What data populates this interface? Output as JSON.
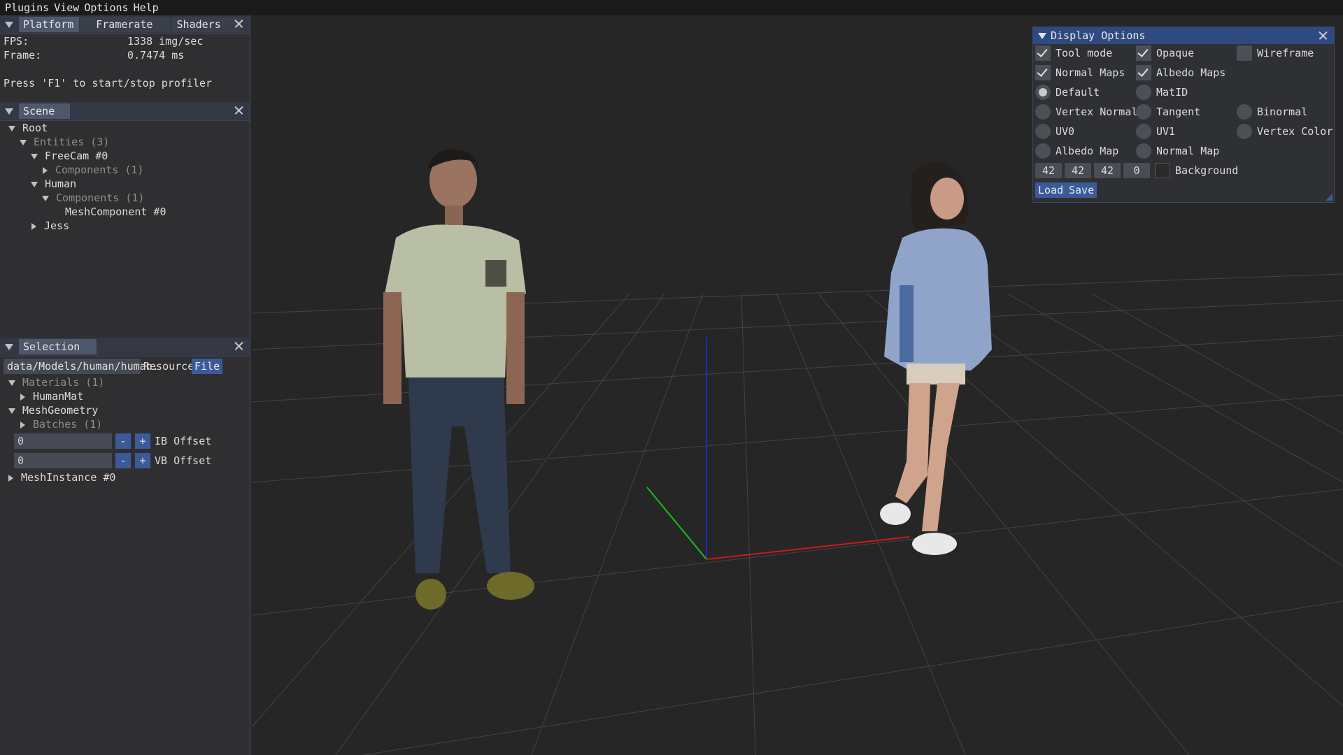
{
  "menubar": {
    "items": [
      "Plugins",
      "View",
      "Options",
      "Help"
    ]
  },
  "profiler": {
    "tabs": [
      "Platform",
      "Framerate",
      "Shaders"
    ],
    "fps_label": "FPS:",
    "fps_value": "1338 img/sec",
    "frame_label": "Frame:",
    "frame_value": "0.7474 ms",
    "hint": "Press 'F1' to start/stop profiler"
  },
  "scene": {
    "title": "Scene",
    "tree": {
      "root": "Root",
      "entities": "Entities (3)",
      "freecam": "FreeCam #0",
      "freecam_components": "Components (1)",
      "human": "Human",
      "human_components": "Components (1)",
      "mesh_component": "MeshComponent #0",
      "jess": "Jess"
    }
  },
  "selection": {
    "title": "Selection",
    "path": "data/Models/human/human.",
    "resource_label": "Resource",
    "file_button": "File",
    "materials": "Materials (1)",
    "human_mat": "HumanMat",
    "mesh_geometry": "MeshGeometry",
    "batches": "Batches (1)",
    "ib_value": "0",
    "ib_label": "IB Offset",
    "vb_value": "0",
    "vb_label": "VB Offset",
    "minus": "-",
    "plus": "+",
    "mesh_instance": "MeshInstance #0"
  },
  "display_options": {
    "title": "Display Options",
    "checkboxes": [
      {
        "label": "Tool mode",
        "checked": true
      },
      {
        "label": "Opaque",
        "checked": true
      },
      {
        "label": "Wireframe",
        "checked": false
      },
      {
        "label": "Normal Maps",
        "checked": true
      },
      {
        "label": "Albedo Maps",
        "checked": true
      }
    ],
    "radios": [
      {
        "label": "Default",
        "selected": true
      },
      {
        "label": "MatID",
        "selected": false
      },
      {
        "label": "Vertex Normal",
        "selected": false
      },
      {
        "label": "Tangent",
        "selected": false
      },
      {
        "label": "Binormal",
        "selected": false
      },
      {
        "label": "UV0",
        "selected": false
      },
      {
        "label": "UV1",
        "selected": false
      },
      {
        "label": "Vertex Color",
        "selected": false
      },
      {
        "label": "Albedo Map",
        "selected": false
      },
      {
        "label": "Normal Map",
        "selected": false
      }
    ],
    "background_rgba": [
      "42",
      "42",
      "42",
      "0"
    ],
    "background_label": "Background",
    "load_button": "Load",
    "save_button": "Save"
  },
  "colors": {
    "accent": "#3b5a99",
    "axis_x": "#d01818",
    "axis_y": "#18c018",
    "axis_z": "#1a2ad0",
    "viewport_bg": "#262626"
  }
}
